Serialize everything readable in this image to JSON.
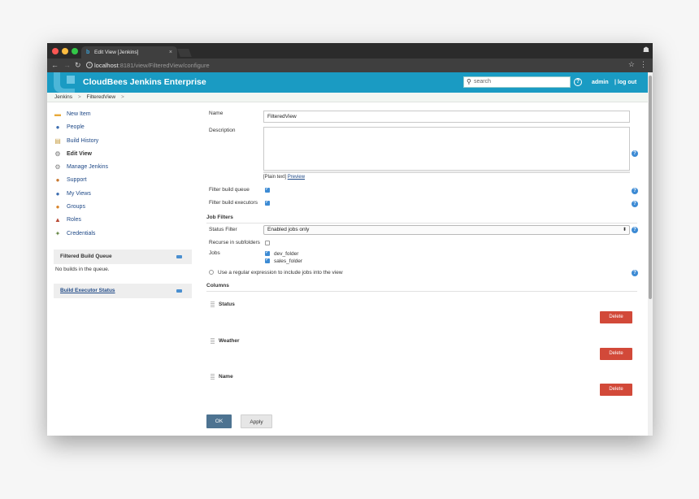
{
  "browser": {
    "tab_title": "Edit View [Jenkins]",
    "tab_close": "×",
    "url_host": "localhost",
    "url_path": ":8181/view/FilteredView/configure"
  },
  "header": {
    "brand": "CloudBees Jenkins Enterprise",
    "search_placeholder": "search",
    "help": "?",
    "user": "admin",
    "logout": "| log out"
  },
  "breadcrumb": [
    "Jenkins",
    ">",
    "FilteredView",
    ">"
  ],
  "sidebar": {
    "items": [
      {
        "label": "New Item",
        "icon": "new-item-icon",
        "color": "#e8a93a",
        "glyph": "▬"
      },
      {
        "label": "People",
        "icon": "people-icon",
        "color": "#3c6db0",
        "glyph": "●"
      },
      {
        "label": "Build History",
        "icon": "notepad-icon",
        "color": "#c9a14a",
        "glyph": "▤"
      },
      {
        "label": "Edit View",
        "icon": "gear-icon",
        "color": "#9a9a9a",
        "glyph": "⚙"
      },
      {
        "label": "Manage Jenkins",
        "icon": "gear-icon",
        "color": "#7f7f7f",
        "glyph": "⚙"
      },
      {
        "label": "Support",
        "icon": "support-icon",
        "color": "#c8782f",
        "glyph": "●"
      },
      {
        "label": "My Views",
        "icon": "my-views-icon",
        "color": "#3c6db0",
        "glyph": "●"
      },
      {
        "label": "Groups",
        "icon": "groups-icon",
        "color": "#d8842a",
        "glyph": "●"
      },
      {
        "label": "Roles",
        "icon": "roles-icon",
        "color": "#b84a35",
        "glyph": "▲"
      },
      {
        "label": "Credentials",
        "icon": "credentials-icon",
        "color": "#6a8a4a",
        "glyph": "✦"
      }
    ],
    "queue_title": "Filtered Build Queue",
    "queue_body": "No builds in the queue.",
    "executor_title": "Build Executor Status"
  },
  "form": {
    "name_label": "Name",
    "name_value": "FilteredView",
    "description_label": "Description",
    "plain_text": "[Plain text]",
    "preview": "Preview",
    "filter_queue_label": "Filter build queue",
    "filter_executors_label": "Filter build executors",
    "job_filters_title": "Job Filters",
    "status_filter_label": "Status Filter",
    "status_filter_value": "Enabled jobs only",
    "recurse_label": "Recurse in subfolders",
    "jobs_label": "Jobs",
    "jobs": [
      "dev_folder",
      "sales_folder"
    ],
    "regex_label": "Use a regular expression to include jobs into the view",
    "columns_title": "Columns",
    "columns": [
      "Status",
      "Weather",
      "Name"
    ],
    "delete_label": "Delete",
    "ok_label": "OK",
    "apply_label": "Apply"
  },
  "colors": {
    "header": "#1a9bc3",
    "delete": "#d24939",
    "ok": "#4d7391",
    "check": "#3d8bd4"
  }
}
